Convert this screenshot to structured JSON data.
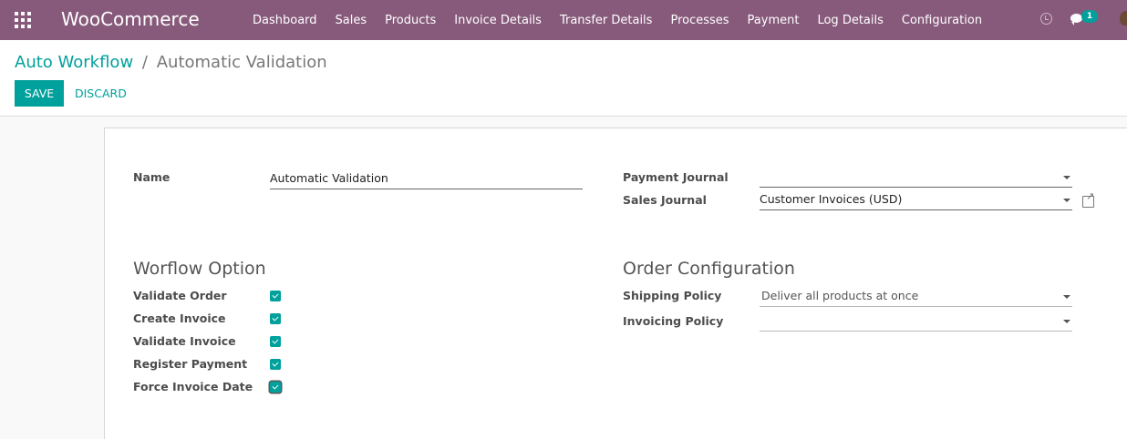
{
  "navbar": {
    "brand": "WooCommerce",
    "menu": [
      "Dashboard",
      "Sales",
      "Products",
      "Invoice Details",
      "Transfer Details",
      "Processes",
      "Payment",
      "Log Details",
      "Configuration"
    ],
    "chat_count": "1",
    "color": "#875a7b"
  },
  "breadcrumb": {
    "parent": "Auto Workflow",
    "separator": "/",
    "current": "Automatic Validation"
  },
  "actions": {
    "save": "SAVE",
    "discard": "DISCARD",
    "accent": "#00a09d"
  },
  "form": {
    "name_label": "Name",
    "name_value": "Automatic Validation",
    "payment_journal_label": "Payment Journal",
    "payment_journal_value": "",
    "sales_journal_label": "Sales Journal",
    "sales_journal_value": "Customer Invoices (USD)",
    "workflow_title": "Worflow Option",
    "options": [
      {
        "label": "Validate Order",
        "checked": true
      },
      {
        "label": "Create Invoice",
        "checked": true
      },
      {
        "label": "Validate Invoice",
        "checked": true
      },
      {
        "label": "Register Payment",
        "checked": true
      },
      {
        "label": "Force Invoice Date",
        "checked": true
      }
    ],
    "order_config_title": "Order Configuration",
    "shipping_policy_label": "Shipping Policy",
    "shipping_policy_value": "Deliver all products at once",
    "invoicing_policy_label": "Invoicing Policy",
    "invoicing_policy_value": ""
  }
}
